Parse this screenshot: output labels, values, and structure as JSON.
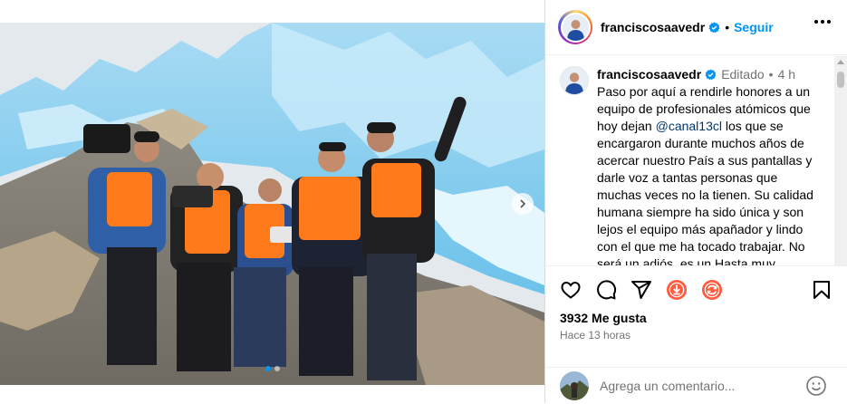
{
  "post": {
    "username": "franciscosaavedr",
    "separator": "•",
    "follow_label": "Seguir",
    "edited_label": "Editado",
    "caption_time": "4 h",
    "caption_before_mention": "Paso por aquí a rendirle honores a un equipo de profesionales atómicos que hoy dejan ",
    "mention": "@canal13cl",
    "caption_after_mention": " los que se encargaron durante muchos años de acercar nuestro País a sus pantallas y darle voz a tantas personas que muchas veces no la tienen. Su calidad humana siempre ha sido única y son lejos el equipo más apañador y lindo con el que me ha tocado trabajar. No será un adiós, es un Hasta muy pronto,",
    "likes": "3932 Me gusta",
    "posted_time": "Hace 13 horas",
    "comment_placeholder": "Agrega un comentario...",
    "carousel": {
      "count": 2,
      "active_index": 0
    }
  },
  "icons": {
    "more": "more-options-icon",
    "verified": "verified-badge-icon",
    "like": "heart-icon",
    "comment": "comment-icon",
    "share": "share-icon",
    "extra1": "download-icon",
    "extra2": "refresh-icon",
    "save": "bookmark-icon",
    "emoji": "emoji-icon",
    "next": "chevron-right-icon"
  },
  "colors": {
    "accent": "#0095f6",
    "mention": "#00376b",
    "secondary_text": "#737373",
    "extension_icons": "#ff5a3c"
  }
}
